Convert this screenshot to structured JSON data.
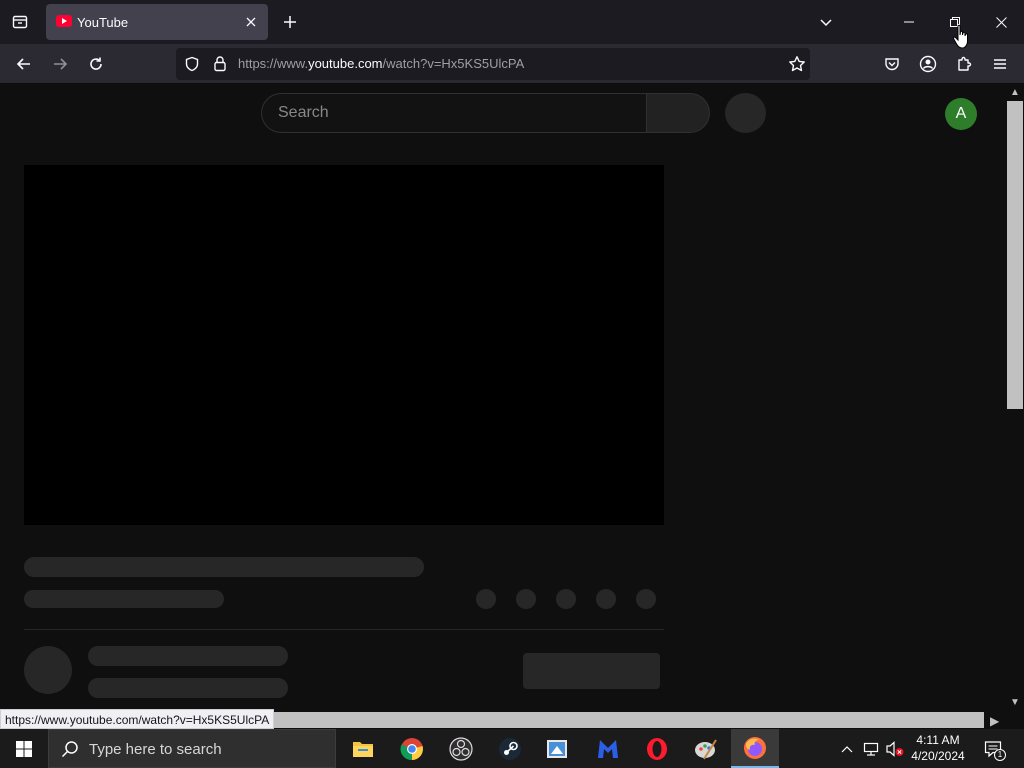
{
  "browser": {
    "tab": {
      "title": "YouTube",
      "favicon": "youtube-icon"
    },
    "url": {
      "prefix": "https://www.",
      "host": "youtube.com",
      "path": "/watch?v=Hx5KS5UlcPA"
    },
    "status_url": "https://www.youtube.com/watch?v=Hx5KS5UlcPA"
  },
  "page": {
    "search": {
      "placeholder": "Search"
    },
    "avatar_letter": "A"
  },
  "taskbar": {
    "search_placeholder": "Type here to search",
    "time": "4:11 AM",
    "date": "4/20/2024",
    "notification_count": "1",
    "apps": [
      "file-explorer-icon",
      "chrome-icon",
      "obs-icon",
      "steam-icon",
      "paint-icon",
      "malwarebytes-icon",
      "opera-icon",
      "paint-tool-icon",
      "firefox-icon"
    ]
  },
  "colors": {
    "page_bg": "#0f0f0f",
    "skeleton": "#272727",
    "avatar": "#2d7d2a",
    "browser_bg": "#1c1b22",
    "taskbar_bg": "#1b1b1b"
  }
}
